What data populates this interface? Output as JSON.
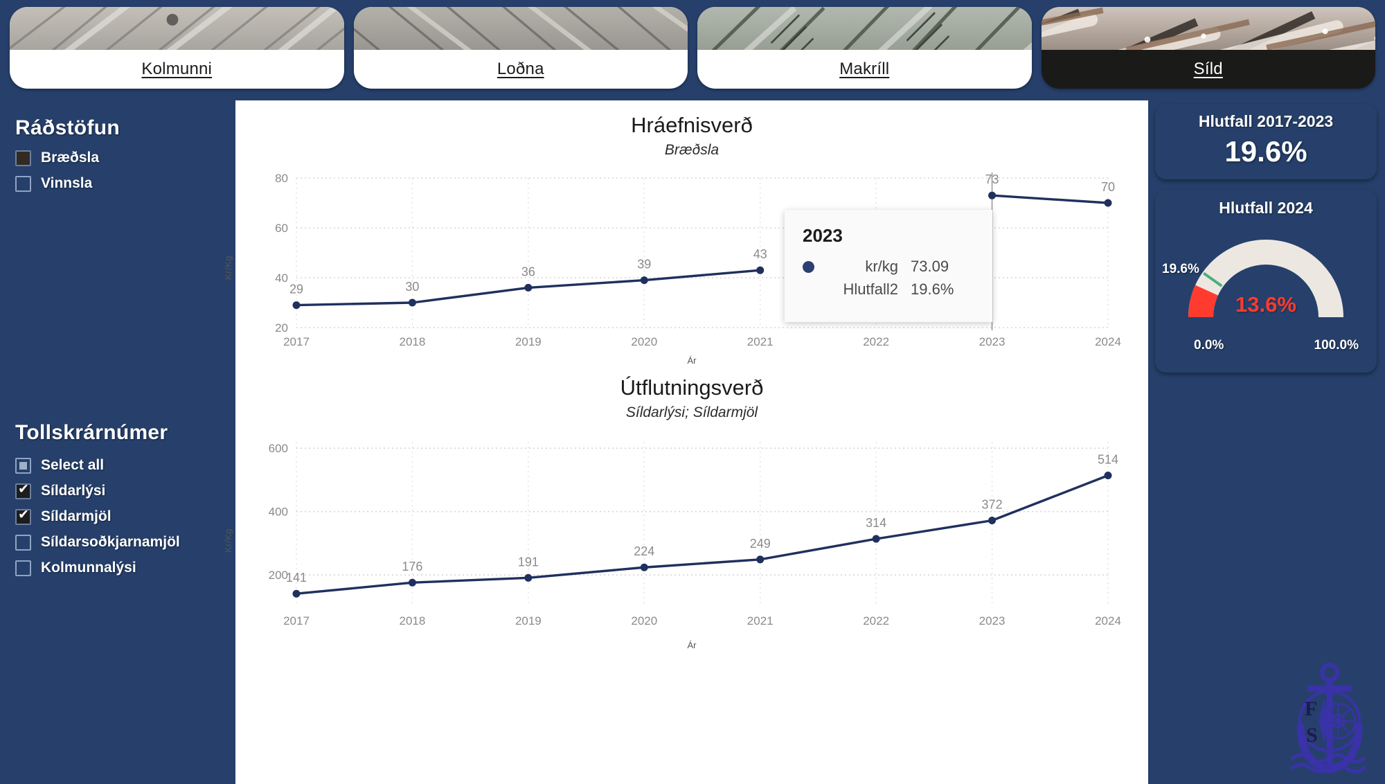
{
  "tabs": [
    {
      "label": "Kolmunni",
      "active": false
    },
    {
      "label": "Loðna",
      "active": false
    },
    {
      "label": "Makríll",
      "active": false
    },
    {
      "label": "Síld",
      "active": true
    }
  ],
  "sidebar": {
    "section1": {
      "title": "Ráðstöfun",
      "options": [
        {
          "label": "Bræðsla",
          "state": "solid"
        },
        {
          "label": "Vinnsla",
          "state": "unchecked"
        }
      ]
    },
    "section2": {
      "title": "Tollskrárnúmer",
      "options": [
        {
          "label": "Select all",
          "state": "partial"
        },
        {
          "label": "Síldarlýsi",
          "state": "checked"
        },
        {
          "label": "Síldarmjöl",
          "state": "checked"
        },
        {
          "label": "Síldarsoðkjarnamjöl",
          "state": "unchecked"
        },
        {
          "label": "Kolmunnalýsi",
          "state": "unchecked"
        }
      ]
    }
  },
  "kpi": {
    "ratio_card": {
      "title": "Hlutfall 2017-2023",
      "value": "19.6%"
    },
    "gauge_card": {
      "title": "Hlutfall 2024",
      "value_label": "13.6%",
      "value": 13.6,
      "target_label": "19.6%",
      "target": 19.6,
      "min_label": "0.0%",
      "max_label": "100.0%",
      "min": 0,
      "max": 100,
      "value_color": "#ff3b30",
      "target_color": "#4caf7d",
      "track_color": "#ece8e1"
    }
  },
  "tooltip": {
    "title": "2023",
    "rows": [
      {
        "key": "kr/kg",
        "value": "73.09",
        "marker": true
      },
      {
        "key": "Hlutfall2",
        "value": "19.6%",
        "marker": false
      }
    ]
  },
  "colors": {
    "navy": "#26406b",
    "line": "#20305e",
    "grid": "#d8d8d8"
  },
  "chart_data": [
    {
      "type": "line",
      "title": "Hráefnisverð",
      "subtitle": "Bræðsla",
      "xlabel": "Ár",
      "ylabel": "Kr/Kg",
      "categories": [
        "2017",
        "2018",
        "2019",
        "2020",
        "2021",
        "2022",
        "2023",
        "2024"
      ],
      "values": [
        29,
        30,
        36,
        39,
        43,
        null,
        73,
        70
      ],
      "labels": [
        "29",
        "30",
        "36",
        "39",
        "43",
        "",
        "73",
        "70"
      ],
      "yticks": [
        20,
        40,
        60,
        80
      ],
      "ylim": [
        20,
        80
      ],
      "grid": true,
      "legend": "none",
      "hover_category": "2023",
      "series_color": "#20305e"
    },
    {
      "type": "line",
      "title": "Útflutningsverð",
      "subtitle": "Síldarlýsi; Síldarmjöl",
      "xlabel": "Ár",
      "ylabel": "Kr/Kg",
      "categories": [
        "2017",
        "2018",
        "2019",
        "2020",
        "2021",
        "2022",
        "2023",
        "2024"
      ],
      "values": [
        141,
        176,
        191,
        224,
        249,
        314,
        372,
        514
      ],
      "labels": [
        "141",
        "176",
        "191",
        "224",
        "249",
        "314",
        "372",
        "514"
      ],
      "yticks": [
        200,
        400,
        600
      ],
      "ylim": [
        100,
        620
      ],
      "grid": true,
      "legend": "none",
      "series_color": "#20305e"
    }
  ],
  "logo": {
    "letters": [
      "F",
      "S"
    ],
    "name": "anchor-compass-logo"
  }
}
